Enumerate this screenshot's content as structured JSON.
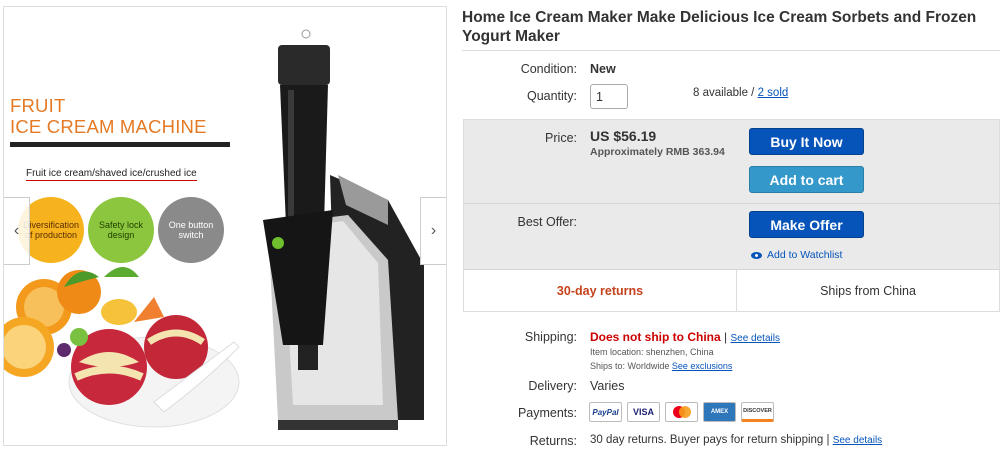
{
  "gallery": {
    "promo_title_line1": "FRUIT",
    "promo_title_line2": "ICE CREAM MACHINE",
    "promo_subtitle": "Fruit ice cream/shaved ice/crushed ice",
    "features": [
      "Diversification of production",
      "Safety lock design",
      "One button switch"
    ],
    "prev_arrow": "‹",
    "next_arrow": "›"
  },
  "product": {
    "title": "Home Ice Cream Maker Make Delicious Ice Cream Sorbets and Frozen Yogurt Maker"
  },
  "condition": {
    "label": "Condition:",
    "value": "New"
  },
  "quantity": {
    "label": "Quantity:",
    "value": "1",
    "available_text": "8 available / ",
    "sold_text": "2 sold"
  },
  "price": {
    "label": "Price:",
    "value": "US $56.19",
    "approx": "Approximately RMB 363.94"
  },
  "buttons": {
    "buy_now": "Buy It Now",
    "add_to_cart": "Add to cart",
    "make_offer": "Make Offer"
  },
  "best_offer": {
    "label": "Best Offer:"
  },
  "watchlist": {
    "label": "Add to Watchlist"
  },
  "badges": {
    "returns": "30-day returns",
    "ships_from": "Ships from China"
  },
  "shipping": {
    "label": "Shipping:",
    "value": "Does not ship to China",
    "sep": " | ",
    "details_link": "See details",
    "item_location": "Item location:  shenzhen, China",
    "ships_to_prefix": "Ships to:  Worldwide  ",
    "exclusions_link": "See exclusions"
  },
  "delivery": {
    "label": "Delivery:",
    "value": "Varies"
  },
  "payments": {
    "label": "Payments:",
    "methods": [
      "PayPal",
      "VISA",
      "MasterCard",
      "AMEX",
      "DISCOVER"
    ]
  },
  "returns": {
    "label": "Returns:",
    "value": "30 day returns. Buyer pays for return shipping | ",
    "details_link": "See details"
  },
  "colors": {
    "ebay_blue": "#0654ba",
    "cart_blue": "#3498ca",
    "returns_red": "#c5421c",
    "accent_orange": "#e47a25"
  }
}
